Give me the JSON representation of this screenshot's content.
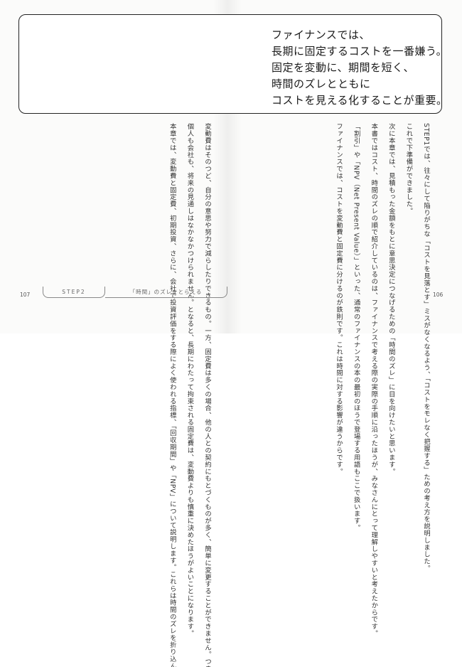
{
  "summary": {
    "lines": [
      "ファイナンスでは、",
      "長期に固定するコストを一番嫌う。",
      "固定を変動に、期間を短く、",
      "時間のズレとともに",
      "コストを見える化することが重要。"
    ]
  },
  "right_page": {
    "paragraphs": [
      "STEP1では、往々にして陥りがちな「コストを見落とす」ミスがなくなるよう、「コストをモレなく把握する」ための考え方を説明しました。",
      "これで下準備ができました。",
      "次に本章では、見積もった金額をもとに意思決定につなげるための「時間のズレ」に目を向けたいと思います。",
      "本書ではコスト、時間のズレの順で紹介しているのは、ファイナンスで考える際の実際の手順に沿ったほうが、みなさんにとって理解しやすいと考えたからです。",
      "「割引」や「NPV（Net Present Value）」といった、通常のファイナンスの本の最初のほうで登場する用語もここで扱います。",
      "ファイナンスでは、コストを変動費と固定費に分けるのが鉄則です。これは時間に対する影響が違うからです。"
    ]
  },
  "left_page": {
    "paragraphs": [
      "変動費はそのつど、自分の意思や努力で減らしたりできるもの。一方、固定費は多くの場合、他の人との契約にもとづくものが多く、簡単に変更することができません。つまり、他の人にコミット（約束）しているため、長期にわたって約束した内容に拘束され、コストが発生し続けることになります。",
      "個人も会社も、将来の見通しはなかなかつけられません。となると、長期にわたって拘束される固定費は、変動費よりも慎重に決めたほうがよいことになります。",
      "本章では、変動費と固定費、初期投資、さらに、会社で投資評価をする際によく使われる指標、「回収期間」や「NPV」について説明します。これらは時間のズレを折り込んで、案件の全体像をひとつの数字で表すものです。時間のズレを見える化する方法、時間の扱い方について解説していきます。"
    ]
  },
  "footer": {
    "left_page_number": "107",
    "right_page_number": "106",
    "step_label": "STEP2",
    "chapter_title": "「時間」のズレをとらえる"
  }
}
